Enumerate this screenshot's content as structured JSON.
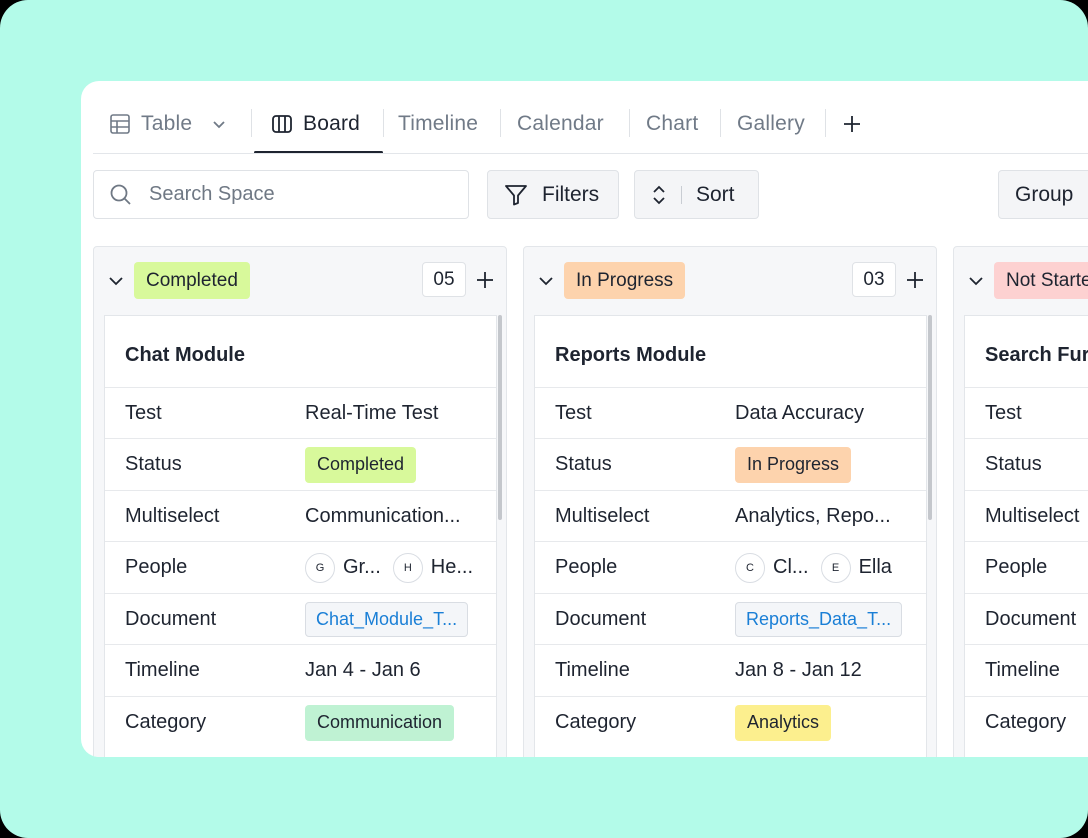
{
  "colors": {
    "backdrop": "#b3fbe9",
    "completed": "#d8f99b",
    "in_progress": "#fdd3ad",
    "not_started": "#fdd1d1",
    "communication": "#bff2d3",
    "analytics": "#fcef8e",
    "link": "#1a7fd6"
  },
  "tabs": [
    {
      "label": "Table",
      "icon": "table-grid-icon"
    },
    {
      "label": "Board",
      "icon": "board-columns-icon"
    },
    {
      "label": "Timeline"
    },
    {
      "label": "Calendar"
    },
    {
      "label": "Chart"
    },
    {
      "label": "Gallery"
    }
  ],
  "active_tab": "Board",
  "toolbar": {
    "search_placeholder": "Search Space",
    "filters_label": "Filters",
    "sort_label": "Sort",
    "group_label": "Group"
  },
  "columns": [
    {
      "status": "Completed",
      "count": "05",
      "card": {
        "title": "Chat Module",
        "fields": {
          "test_label": "Test",
          "test": "Real-Time Test",
          "status_label": "Status",
          "status": "Completed",
          "multiselect_label": "Multiselect",
          "multiselect": "Communication...",
          "people_label": "People",
          "people": [
            {
              "initial": "G",
              "name": "Gr..."
            },
            {
              "initial": "H",
              "name": "He..."
            }
          ],
          "document_label": "Document",
          "document": "Chat_Module_T...",
          "timeline_label": "Timeline",
          "timeline": "Jan 4 - Jan 6",
          "category_label": "Category",
          "category": "Communication"
        }
      }
    },
    {
      "status": "In Progress",
      "count": "03",
      "card": {
        "title": "Reports Module",
        "fields": {
          "test_label": "Test",
          "test": "Data Accuracy",
          "status_label": "Status",
          "status": "In Progress",
          "multiselect_label": "Multiselect",
          "multiselect": "Analytics, Repo...",
          "people_label": "People",
          "people": [
            {
              "initial": "C",
              "name": "Cl..."
            },
            {
              "initial": "E",
              "name": "Ella"
            }
          ],
          "document_label": "Document",
          "document": "Reports_Data_T...",
          "timeline_label": "Timeline",
          "timeline": "Jan 8 - Jan 12",
          "category_label": "Category",
          "category": "Analytics"
        }
      }
    },
    {
      "status": "Not Starte",
      "card": {
        "title": "Search Fur",
        "fields": {
          "test_label": "Test",
          "status_label": "Status",
          "multiselect_label": "Multiselect",
          "people_label": "People",
          "document_label": "Document",
          "timeline_label": "Timeline",
          "category_label": "Category"
        }
      }
    }
  ]
}
